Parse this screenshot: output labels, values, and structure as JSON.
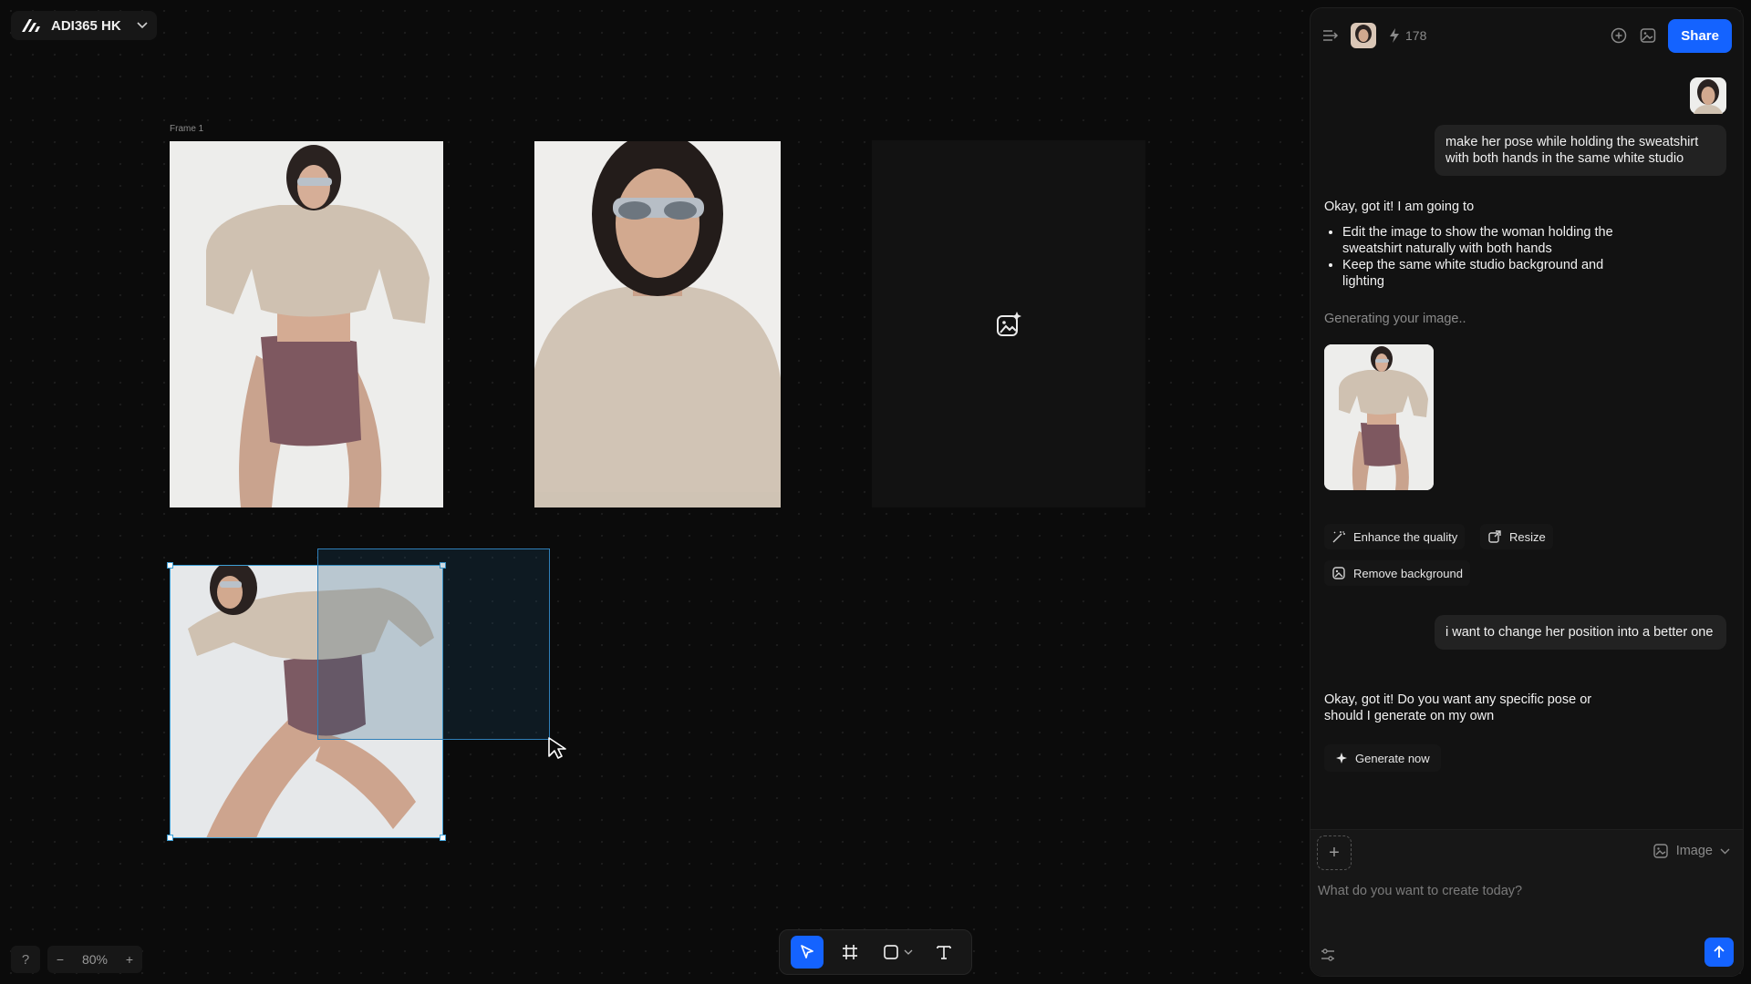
{
  "workspace": {
    "name": "ADI365 HK"
  },
  "canvas": {
    "frame_label": "Frame 1",
    "zoom": "80%",
    "help": "?"
  },
  "toolbar": {
    "active_tool": "select"
  },
  "panel": {
    "credits": "178",
    "share_label": "Share",
    "messages": {
      "user1": "make her pose while holding the sweatshirt with both hands in the same white studio",
      "ai1_intro": "Okay, got it! I am going to",
      "ai1_bullet1": "Edit the image to show the woman holding the sweatshirt naturally with both hands",
      "ai1_bullet2": "Keep the same white studio background and lighting",
      "generating": "Generating your image..",
      "action_enhance": "Enhance the quality",
      "action_resize": "Resize",
      "action_remove_bg": "Remove background",
      "user2": "i want to change her position into a better one",
      "ai2": "Okay, got it! Do you want any specific pose or should I generate on my own",
      "generate_now": "Generate now"
    },
    "composer": {
      "mode": "Image",
      "placeholder": "What do you want to create today?"
    }
  },
  "colors": {
    "accent": "#1463ff",
    "selection": "#3fa0d6"
  }
}
